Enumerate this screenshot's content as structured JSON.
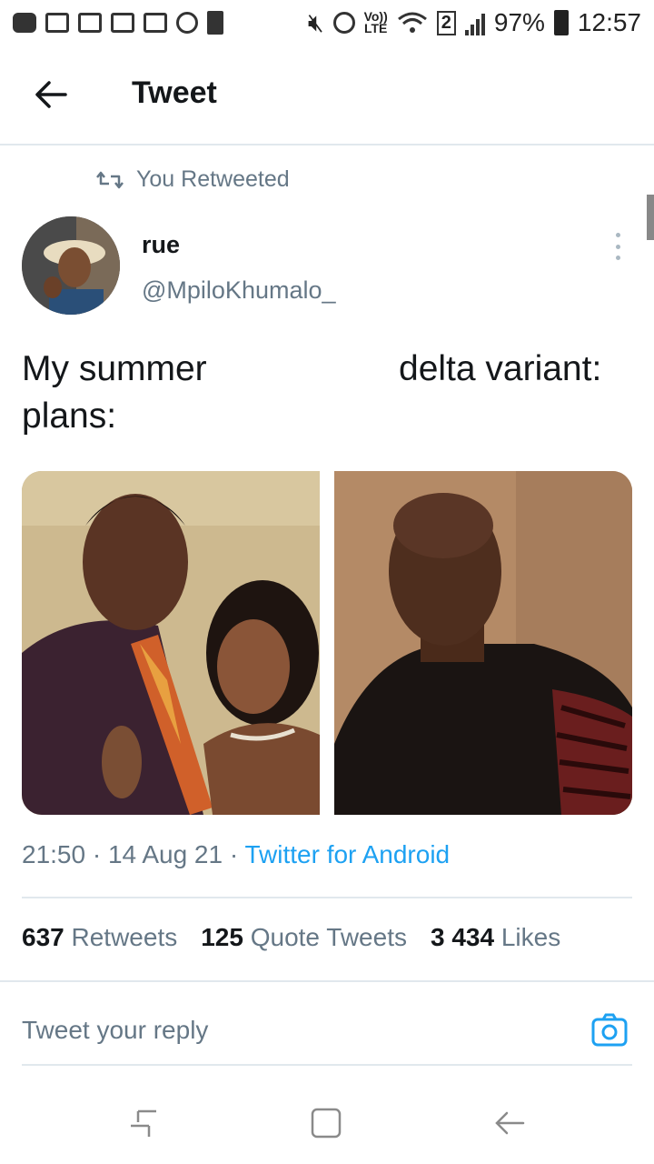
{
  "status_bar": {
    "battery": "97%",
    "time": "12:57",
    "lte_label": "LTE",
    "volte_label": "Vo))",
    "sim_label": "2"
  },
  "header": {
    "title": "Tweet",
    "back_icon": "arrow-left-icon"
  },
  "retweet_context": "You Retweeted",
  "author": {
    "name": "rue",
    "handle": "@MpiloKhumalo_"
  },
  "tweet": {
    "text_left": "My summer plans:",
    "text_right": "delta variant:",
    "timestamp": "21:50 · 14 Aug 21 · ",
    "source": "Twitter for Android"
  },
  "stats": [
    {
      "count": "637",
      "label": "Retweets"
    },
    {
      "count": "125",
      "label": "Quote Tweets"
    },
    {
      "count": "3 434",
      "label": "Likes"
    }
  ],
  "reply": {
    "placeholder": "Tweet your reply",
    "camera_icon": "camera-icon"
  },
  "colors": {
    "accent": "#1da1f2",
    "secondary_text": "#657786",
    "divider": "#e1e8ed"
  }
}
